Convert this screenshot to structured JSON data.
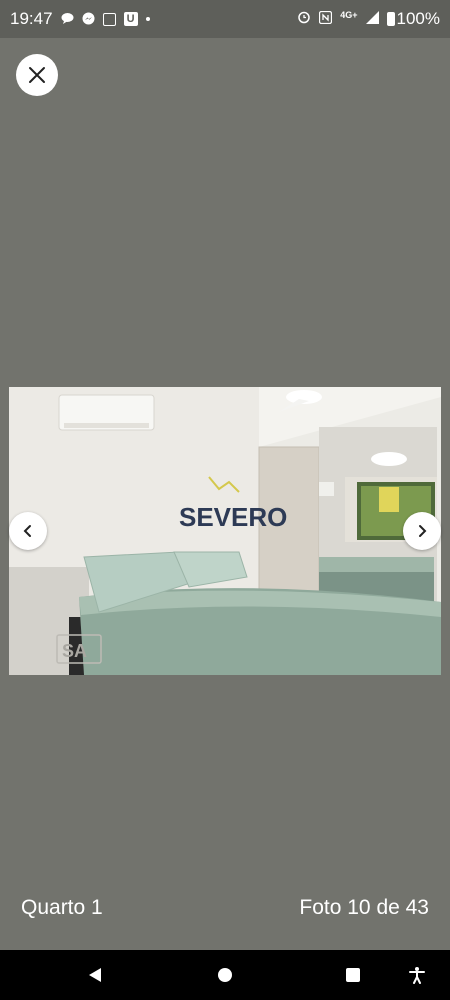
{
  "status_bar": {
    "time": "19:47",
    "network": "4G+",
    "battery": "100%",
    "icons": [
      "chat-icon",
      "messenger-icon",
      "instagram-icon",
      "u-app-icon",
      "dot-icon",
      "alarm-icon",
      "nfc-icon",
      "signal-icon",
      "battery-icon"
    ],
    "u_letter": "U"
  },
  "viewer": {
    "close_icon": "close-icon",
    "prev_icon": "chevron-left-icon",
    "next_icon": "chevron-right-icon"
  },
  "photo": {
    "watermark_text": "SEVERO",
    "logo_text": "SA",
    "description": "bedroom-photo"
  },
  "caption": {
    "room_label": "Quarto 1",
    "photo_counter": "Foto 10 de 43"
  },
  "nav_bar": {
    "icons": [
      "back-icon",
      "home-icon",
      "recents-icon",
      "accessibility-icon"
    ]
  },
  "colors": {
    "background": "#72736d",
    "status_bar": "#5e5f5a",
    "nav_bar": "#000000"
  }
}
